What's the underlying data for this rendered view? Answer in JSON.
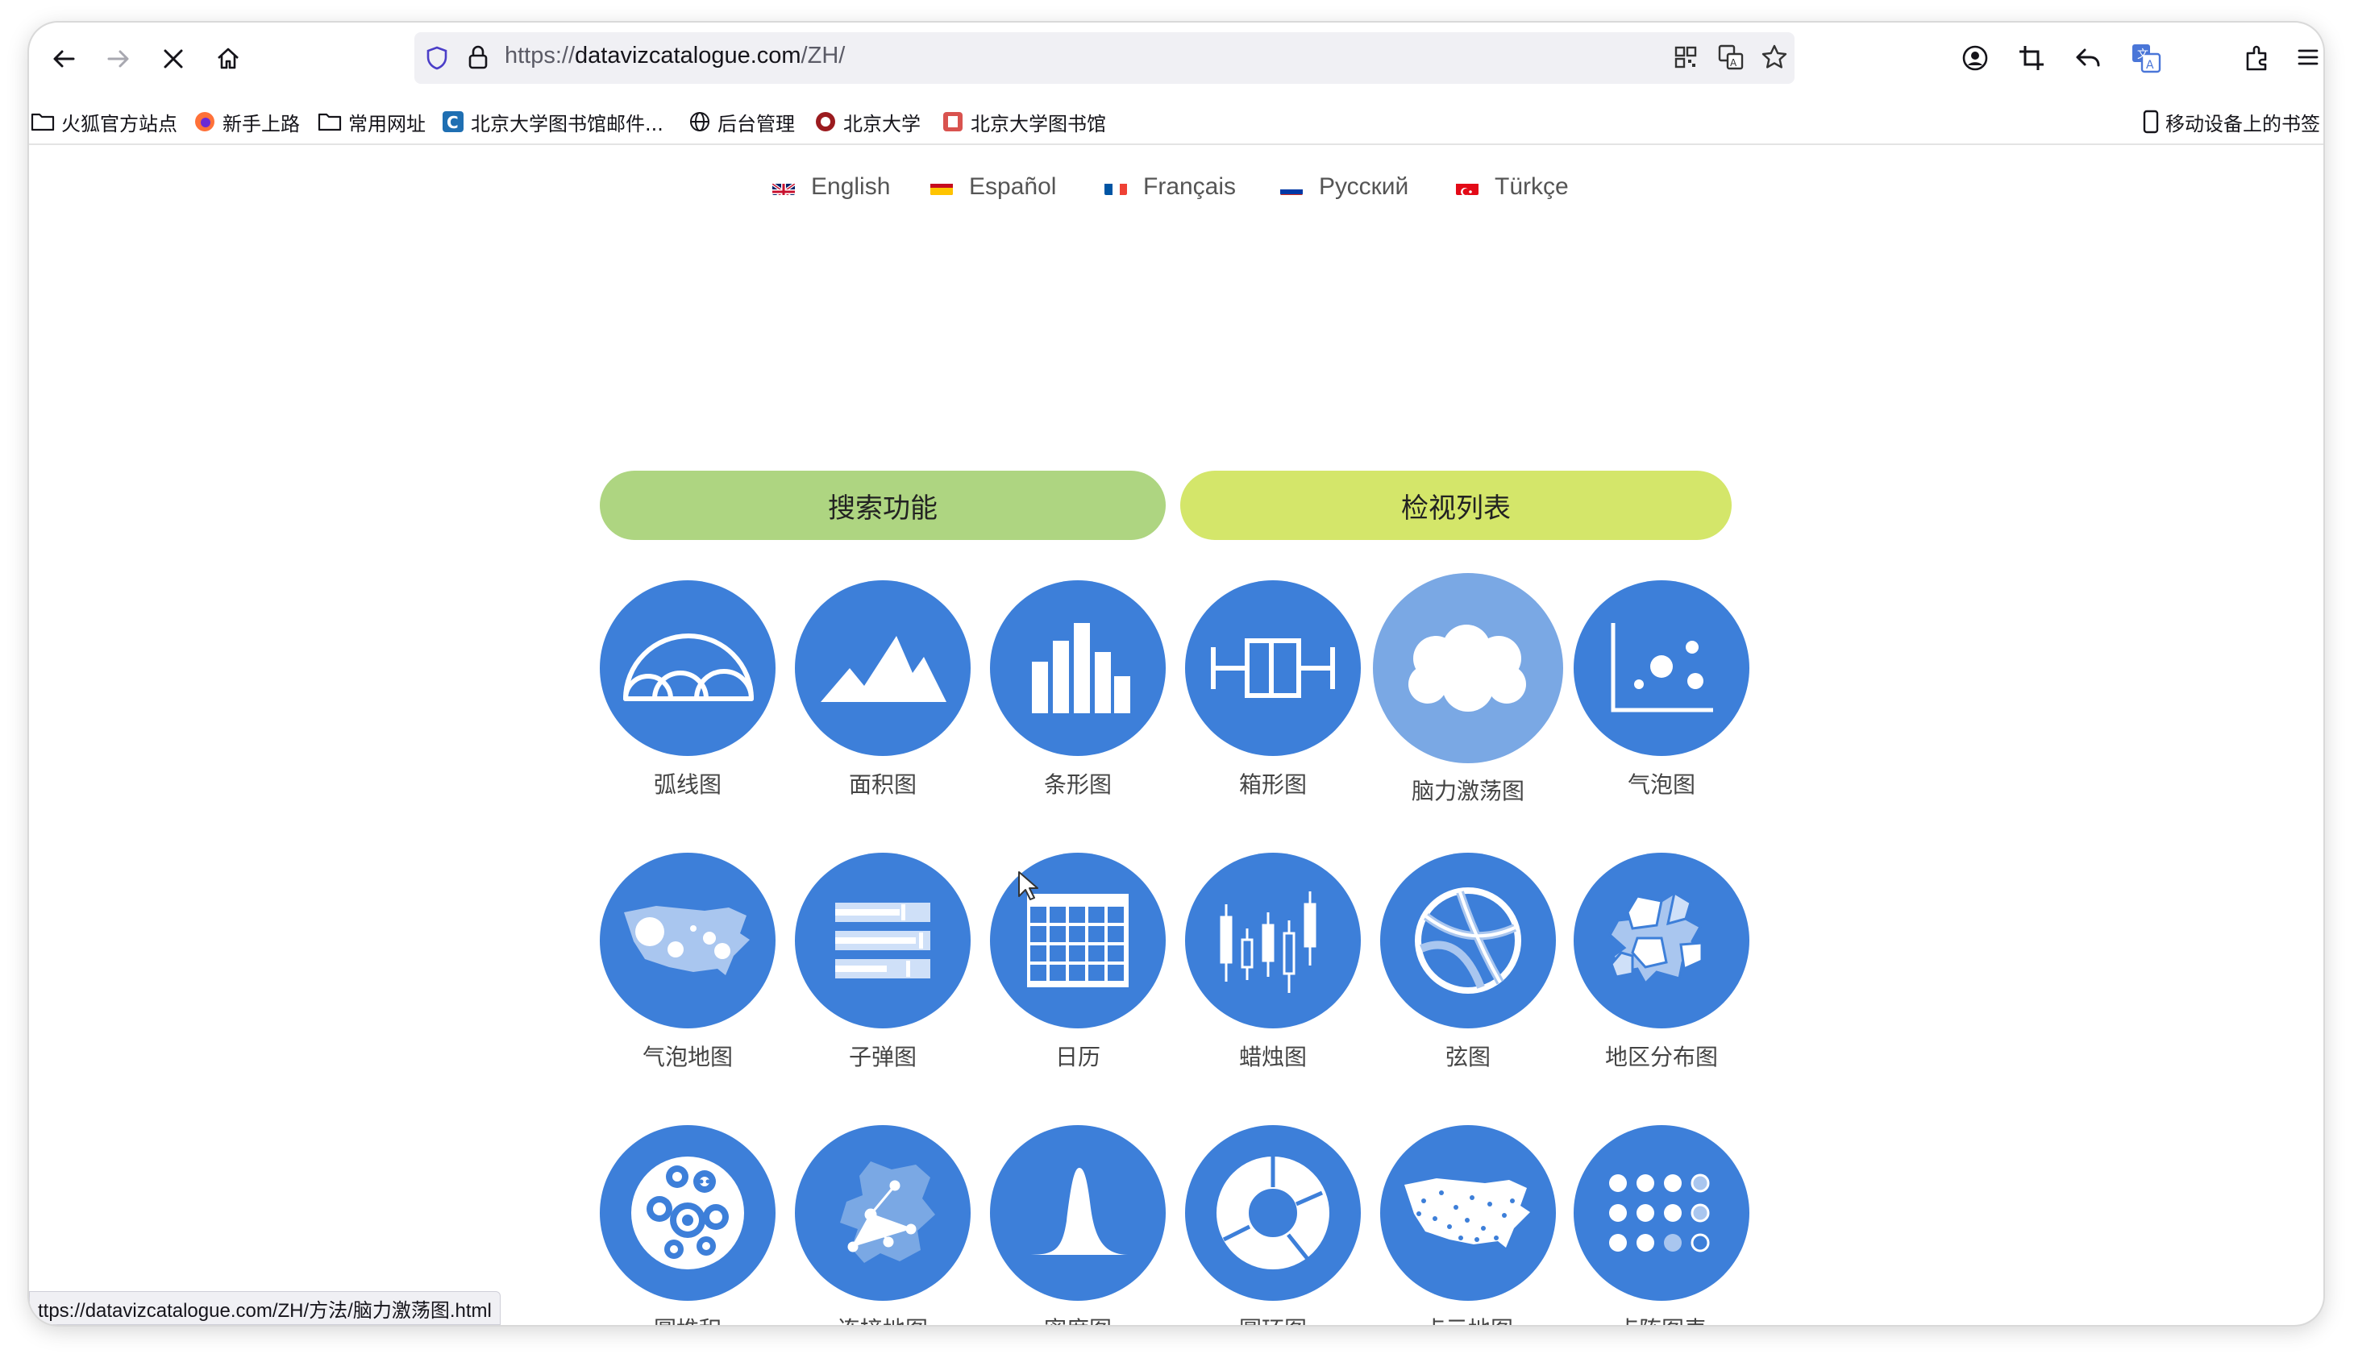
{
  "browser": {
    "url_prefix": "https://",
    "url_host": "datavizcatalogue.com",
    "url_path": "/ZH/",
    "status_url": "ttps://datavizcatalogue.com/ZH/方法/脑力激荡图.html"
  },
  "bookmarks": [
    {
      "label": "火狐官方站点",
      "icon": "folder-icon"
    },
    {
      "label": "新手上路",
      "icon": "firefox-icon"
    },
    {
      "label": "常用网址",
      "icon": "folder-icon"
    },
    {
      "label": "北京大学图书馆邮件...",
      "icon": "c-logo-icon"
    },
    {
      "label": "后台管理",
      "icon": "globe-icon"
    },
    {
      "label": "北京大学",
      "icon": "pku-logo-icon"
    },
    {
      "label": "北京大学图书馆",
      "icon": "library-icon"
    }
  ],
  "mobile_bookmarks": "移动设备上的书签",
  "languages": [
    {
      "label": "English",
      "flag": "uk-flag-icon"
    },
    {
      "label": "Español",
      "flag": "spain-flag-icon"
    },
    {
      "label": "Français",
      "flag": "france-flag-icon"
    },
    {
      "label": "Русский",
      "flag": "russia-flag-icon"
    },
    {
      "label": "Türkçe",
      "flag": "turkey-flag-icon"
    }
  ],
  "buttons": {
    "search": "搜索功能",
    "list": "检视列表"
  },
  "charts": [
    {
      "label": "弧线图",
      "icon": "arc-diagram-icon"
    },
    {
      "label": "面积图",
      "icon": "area-chart-icon"
    },
    {
      "label": "条形图",
      "icon": "bar-chart-icon"
    },
    {
      "label": "箱形图",
      "icon": "box-plot-icon"
    },
    {
      "label": "脑力激荡图",
      "icon": "brainstorm-icon"
    },
    {
      "label": "气泡图",
      "icon": "bubble-chart-icon"
    },
    {
      "label": "气泡地图",
      "icon": "bubble-map-icon"
    },
    {
      "label": "子弹图",
      "icon": "bullet-graph-icon"
    },
    {
      "label": "日历",
      "icon": "calendar-icon"
    },
    {
      "label": "蜡烛图",
      "icon": "candlestick-icon"
    },
    {
      "label": "弦图",
      "icon": "chord-diagram-icon"
    },
    {
      "label": "地区分布图",
      "icon": "choropleth-icon"
    },
    {
      "label": "圆堆积",
      "icon": "circle-packing-icon"
    },
    {
      "label": "连接地图",
      "icon": "connection-map-icon"
    },
    {
      "label": "密度图",
      "icon": "density-plot-icon"
    },
    {
      "label": "圆环图",
      "icon": "donut-chart-icon"
    },
    {
      "label": "点示地图",
      "icon": "dot-map-icon"
    },
    {
      "label": "点阵图表",
      "icon": "dot-matrix-icon"
    }
  ],
  "colors": {
    "circle": "#3d7fd9",
    "circle_hover": "#7aa8e4",
    "search_button": "#aed581",
    "list_button": "#d4e66a"
  }
}
